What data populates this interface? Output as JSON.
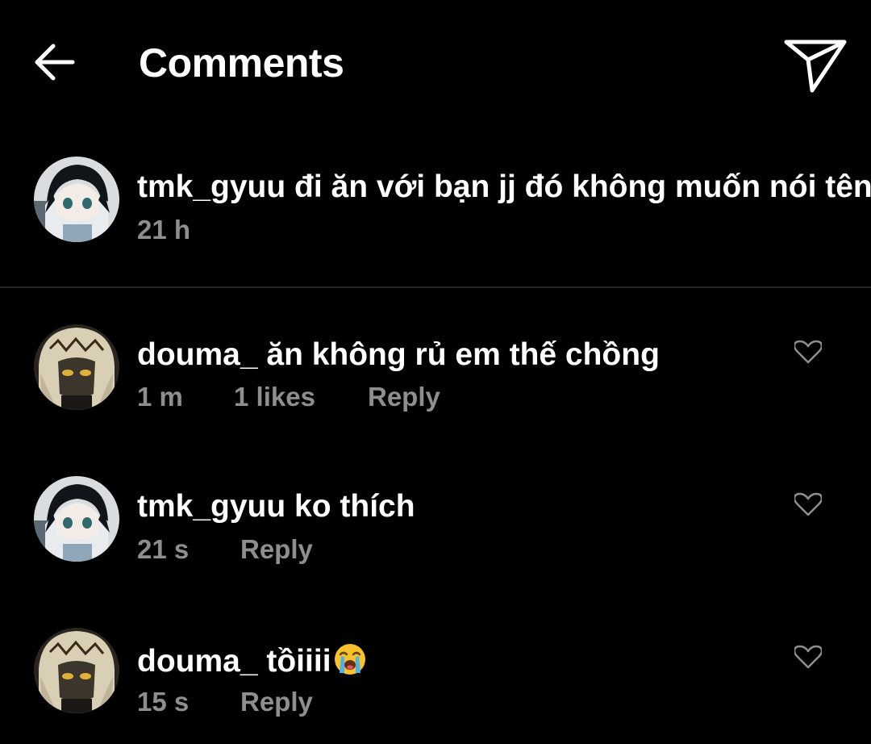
{
  "header": {
    "back_icon": "arrow-left-icon",
    "title": "Comments",
    "share_icon": "paper-plane-icon"
  },
  "caption": {
    "avatar": "anime-avatar-black-hair",
    "username": "tmk_gyuu",
    "text": "đi ăn với bạn jj đó không muốn nói tên",
    "time": "21 h"
  },
  "comments": [
    {
      "avatar": "anime-avatar-blonde",
      "username": "douma_",
      "text": "ăn không rủ em thế chồng",
      "time": "1 m",
      "likes": "1 likes",
      "reply": "Reply",
      "heart_icon": "heart-outline-icon"
    },
    {
      "avatar": "anime-avatar-black-hair",
      "username": "tmk_gyuu",
      "text": "ko thích",
      "time": "21 s",
      "reply": "Reply",
      "heart_icon": "heart-outline-icon"
    },
    {
      "avatar": "anime-avatar-blonde",
      "username": "douma_",
      "text": "tồiiii",
      "emoji": "loudly-crying-face-emoji",
      "time": "15 s",
      "reply": "Reply",
      "heart_icon": "heart-outline-icon"
    }
  ],
  "colors": {
    "background": "#000000",
    "text": "#ffffff",
    "secondary_text": "#8e8e8e",
    "divider": "#262626"
  }
}
